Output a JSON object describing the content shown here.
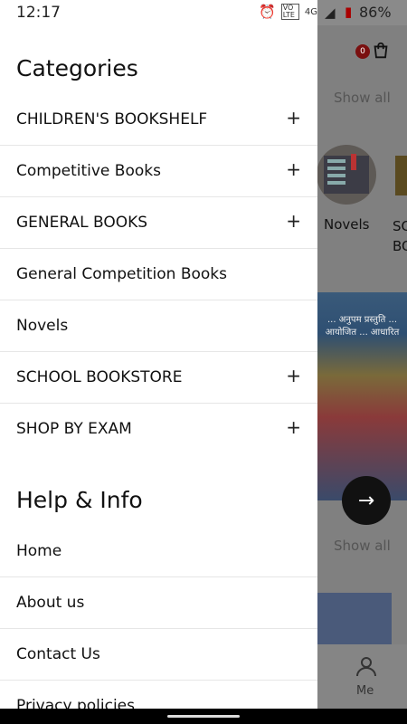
{
  "status": {
    "time": "12:17",
    "volte_badge": "VO LTE",
    "network": "4G",
    "battery": "86%"
  },
  "drawer": {
    "categories_title": "Categories",
    "categories": [
      {
        "label": "CHILDREN'S BOOKSHELF",
        "expand": "+"
      },
      {
        "label": "Competitive Books",
        "expand": "+"
      },
      {
        "label": "GENERAL BOOKS",
        "expand": "+"
      },
      {
        "label": "General Competition Books",
        "expand": ""
      },
      {
        "label": "Novels",
        "expand": ""
      },
      {
        "label": "SCHOOL BOOKSTORE",
        "expand": "+"
      },
      {
        "label": "SHOP BY EXAM",
        "expand": "+"
      }
    ],
    "help_title": "Help & Info",
    "help_items": [
      {
        "label": "Home"
      },
      {
        "label": "About us"
      },
      {
        "label": "Contact Us"
      },
      {
        "label": "Privacy policies"
      }
    ]
  },
  "background": {
    "cart_count": "0",
    "show_all": "Show all",
    "category_novels": "Novels",
    "category_school": "SC BO",
    "book_banner_text": "... अनुपम प्रस्तुति ... आयोजित ... आधारित",
    "fab_arrow": "→",
    "nav_me": "Me"
  }
}
